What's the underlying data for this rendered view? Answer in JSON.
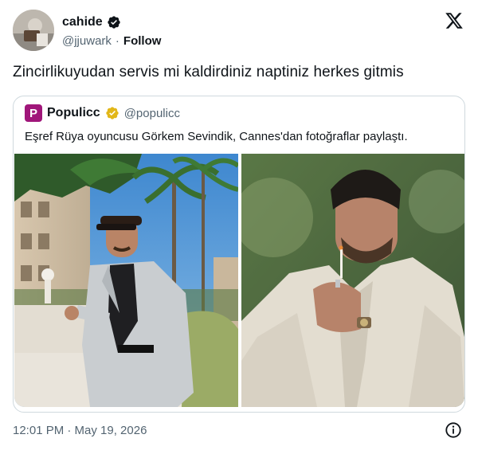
{
  "tweet": {
    "author_name": "cahide",
    "author_handle": "@jjuwark",
    "separator": "·",
    "follow_label": "Follow",
    "text": "Zincirlikuyudan servis mi kaldirdiniz naptiniz herkes gitmis",
    "timestamp": "12:01 PM · May 19, 2026"
  },
  "quoted": {
    "logo_letter": "P",
    "name": "Populicc",
    "handle": "@populicc",
    "text": "Eşref Rüya oyuncusu Görkem Sevindik, Cannes'dan fotoğraflar paylaştı."
  },
  "colors": {
    "verified_blue": "#1d9bf0",
    "verified_gold": "#e2b719",
    "brand_magenta": "#a0167a",
    "muted_text": "#536471"
  },
  "icons": {
    "platform_logo": "x-logo-icon",
    "verified": "verified-badge-icon",
    "info": "info-icon"
  }
}
